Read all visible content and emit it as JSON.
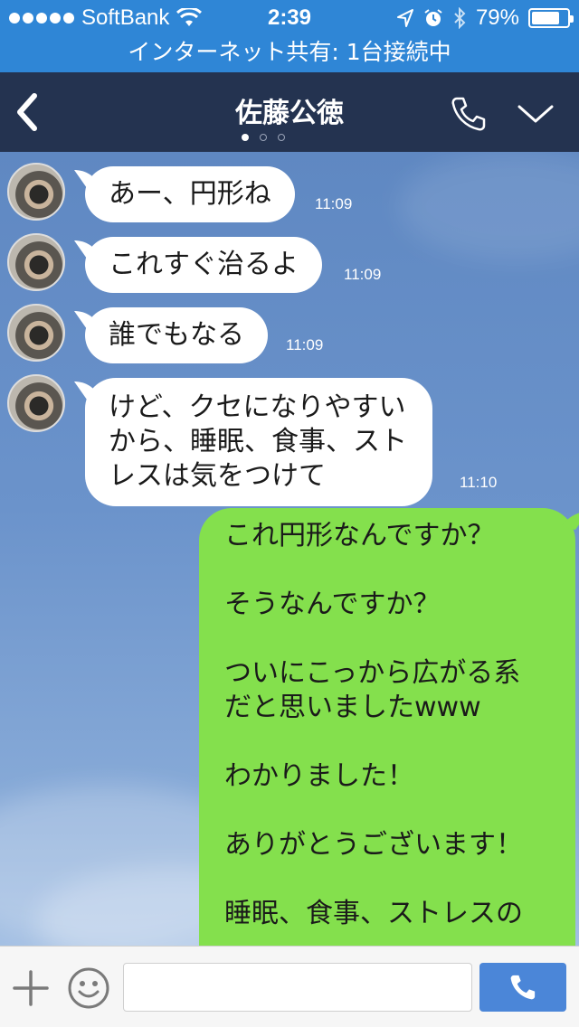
{
  "status_bar": {
    "carrier": "SoftBank",
    "time": "2:39",
    "battery_text": "79%",
    "battery_level": 0.79
  },
  "tether_bar": {
    "text": "インターネット共有: 1台接続中"
  },
  "header": {
    "contact_name": "佐藤公徳",
    "page_count": 3,
    "page_index": 0
  },
  "messages": [
    {
      "side": "in",
      "text": "あー、円形ね",
      "time": "11:09"
    },
    {
      "side": "in",
      "text": "これすぐ治るよ",
      "time": "11:09"
    },
    {
      "side": "in",
      "text": "誰でもなる",
      "time": "11:09"
    },
    {
      "side": "in",
      "lines": [
        "けど、クセになりやすい",
        "から、睡眠、食事、スト",
        "レスは気をつけて"
      ],
      "time": "11:10"
    },
    {
      "side": "out",
      "paragraphs": [
        "これ円形なんですか？",
        "そうなんですか？",
        "ついにこっから広がる系\nだと思いましたwww",
        "わかりました！",
        "ありがとうございます！",
        "睡眠、食事、ストレスの"
      ]
    }
  ],
  "input": {
    "value": "",
    "placeholder": ""
  },
  "colors": {
    "status_bg": "#2f86d6",
    "header_bg": "#243350",
    "outgoing_bubble": "#84e04d",
    "incoming_bubble": "#ffffff",
    "send_button": "#4b86d8"
  },
  "icons": {
    "back": "chevron-left-icon",
    "call": "phone-icon",
    "menu": "chevron-down-icon",
    "add": "plus-icon",
    "sticker": "smiley-icon",
    "send": "phone-icon",
    "wifi": "wifi-icon",
    "location": "location-arrow-icon",
    "alarm": "alarm-icon",
    "bluetooth": "bluetooth-icon"
  }
}
